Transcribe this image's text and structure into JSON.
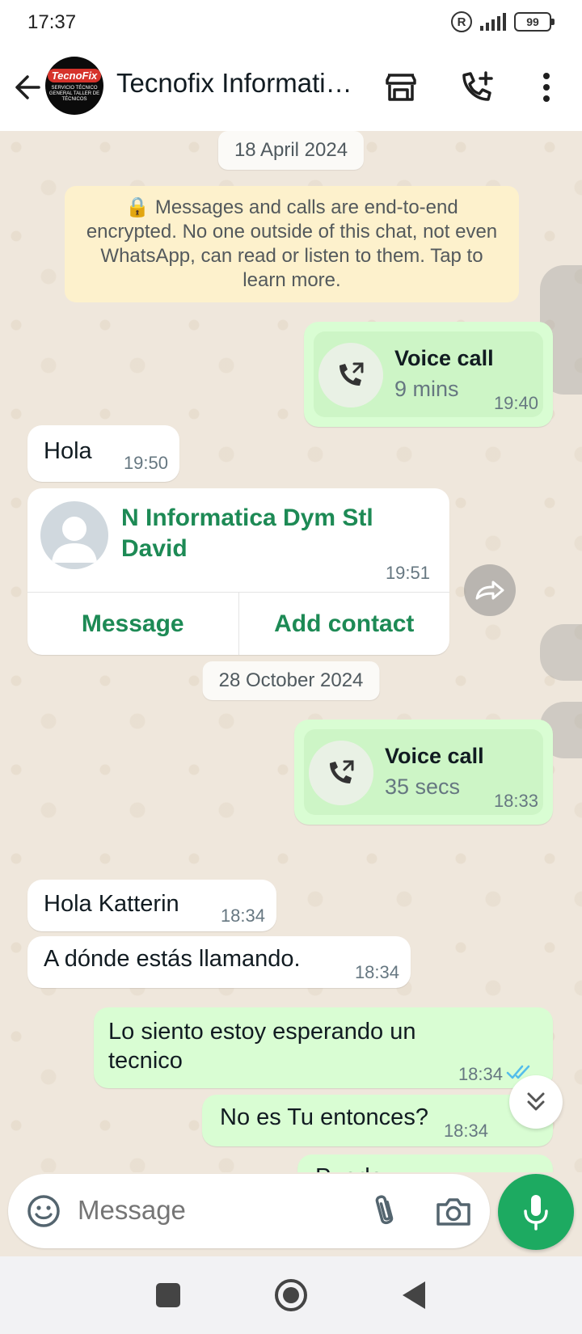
{
  "status_bar": {
    "time": "17:37",
    "battery": "99",
    "reg_mark": "R"
  },
  "header": {
    "title": "Tecnofix Informati…",
    "avatar_logo": "TecnoFix",
    "avatar_sub": "SERVICIO TÉCNICO GENERAL TALLER DE TÉCNICOS",
    "icons": [
      "back-arrow-icon",
      "storefront-icon",
      "add-call-icon",
      "more-options-icon"
    ]
  },
  "chat": {
    "date_1": "18 April 2024",
    "encryption_notice": "🔒 Messages and calls are end-to-end encrypted. No one outside of this chat, not even WhatsApp, can read or listen to them. Tap to learn more.",
    "call_1": {
      "title": "Voice call",
      "duration": "9 mins",
      "time": "19:40"
    },
    "msg_hola": {
      "text": "Hola",
      "time": "19:50"
    },
    "contact_card": {
      "name": "N Informatica Dym Stl David",
      "time": "19:51",
      "action_message": "Message",
      "action_add": "Add contact"
    },
    "date_2": "28 October 2024",
    "call_2": {
      "title": "Voice call",
      "duration": "35 secs",
      "time": "18:33"
    },
    "msg_hola_katterin": {
      "text": "Hola Katterin",
      "time": "18:34"
    },
    "msg_donde": {
      "text": "A dónde estás llamando.",
      "time": "18:34"
    },
    "msg_lo_siento": {
      "text": "Lo siento estoy esperando un tecnico",
      "time": "18:34"
    },
    "msg_no_es": {
      "text": "No es Tu entonces?",
      "time": "18:34"
    },
    "msg_partial": {
      "text": "Puede…"
    }
  },
  "composer": {
    "placeholder": "Message"
  },
  "colors": {
    "accent": "#1daa61",
    "outgoing": "#d9fdd3",
    "contact_green": "#1d8a55",
    "read_ticks": "#53bdeb"
  }
}
